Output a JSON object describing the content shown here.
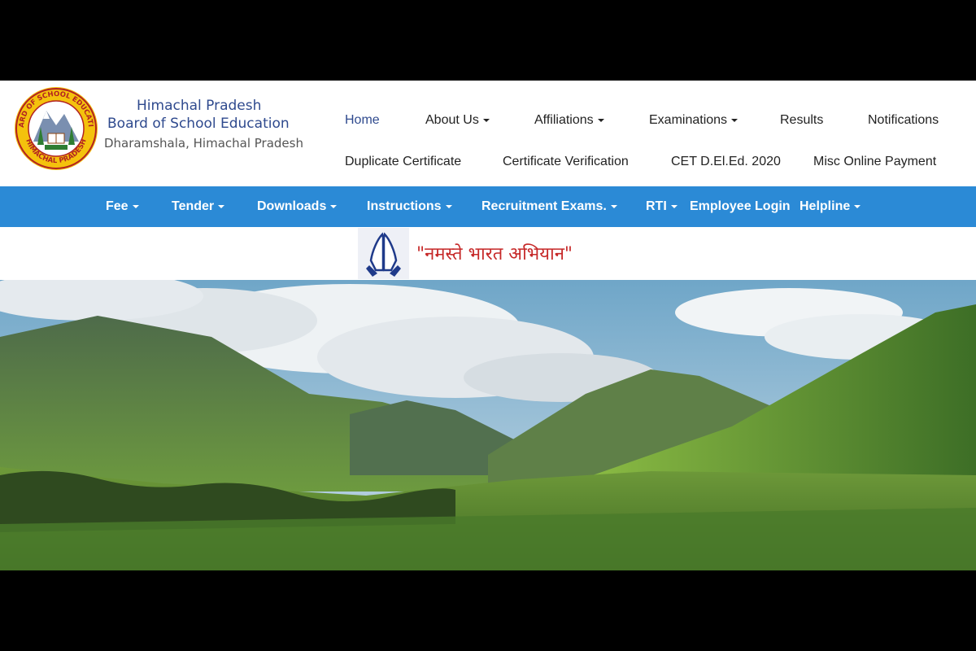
{
  "brand": {
    "line1": "Himachal Pradesh",
    "line2": "Board of School Education",
    "line3": "Dharamshala, Himachal Pradesh",
    "seal_text_top": "BOARD OF SCHOOL EDUCATION",
    "seal_text_bottom": "HIMACHAL PRADESH"
  },
  "top_nav": {
    "row1": [
      "Home",
      "About Us",
      "Affiliations",
      "Examinations",
      "Results",
      "Notifications"
    ],
    "row2": [
      "Duplicate Certificate",
      "Certificate Verification",
      "CET D.El.Ed. 2020",
      "Misc Online Payment"
    ]
  },
  "blue_nav": [
    "Fee",
    "Tender",
    "Downloads",
    "Instructions",
    "Recruitment Exams.",
    "RTI",
    "Employee Login",
    "Helpline"
  ],
  "campaign": {
    "text": "\"नमस्ते भारत अभियान\"",
    "icon": "folded-hands-icon"
  },
  "colors": {
    "brand_blue": "#2f4a8e",
    "nav_bar": "#2b8ad6",
    "campaign_red": "#c62828"
  }
}
